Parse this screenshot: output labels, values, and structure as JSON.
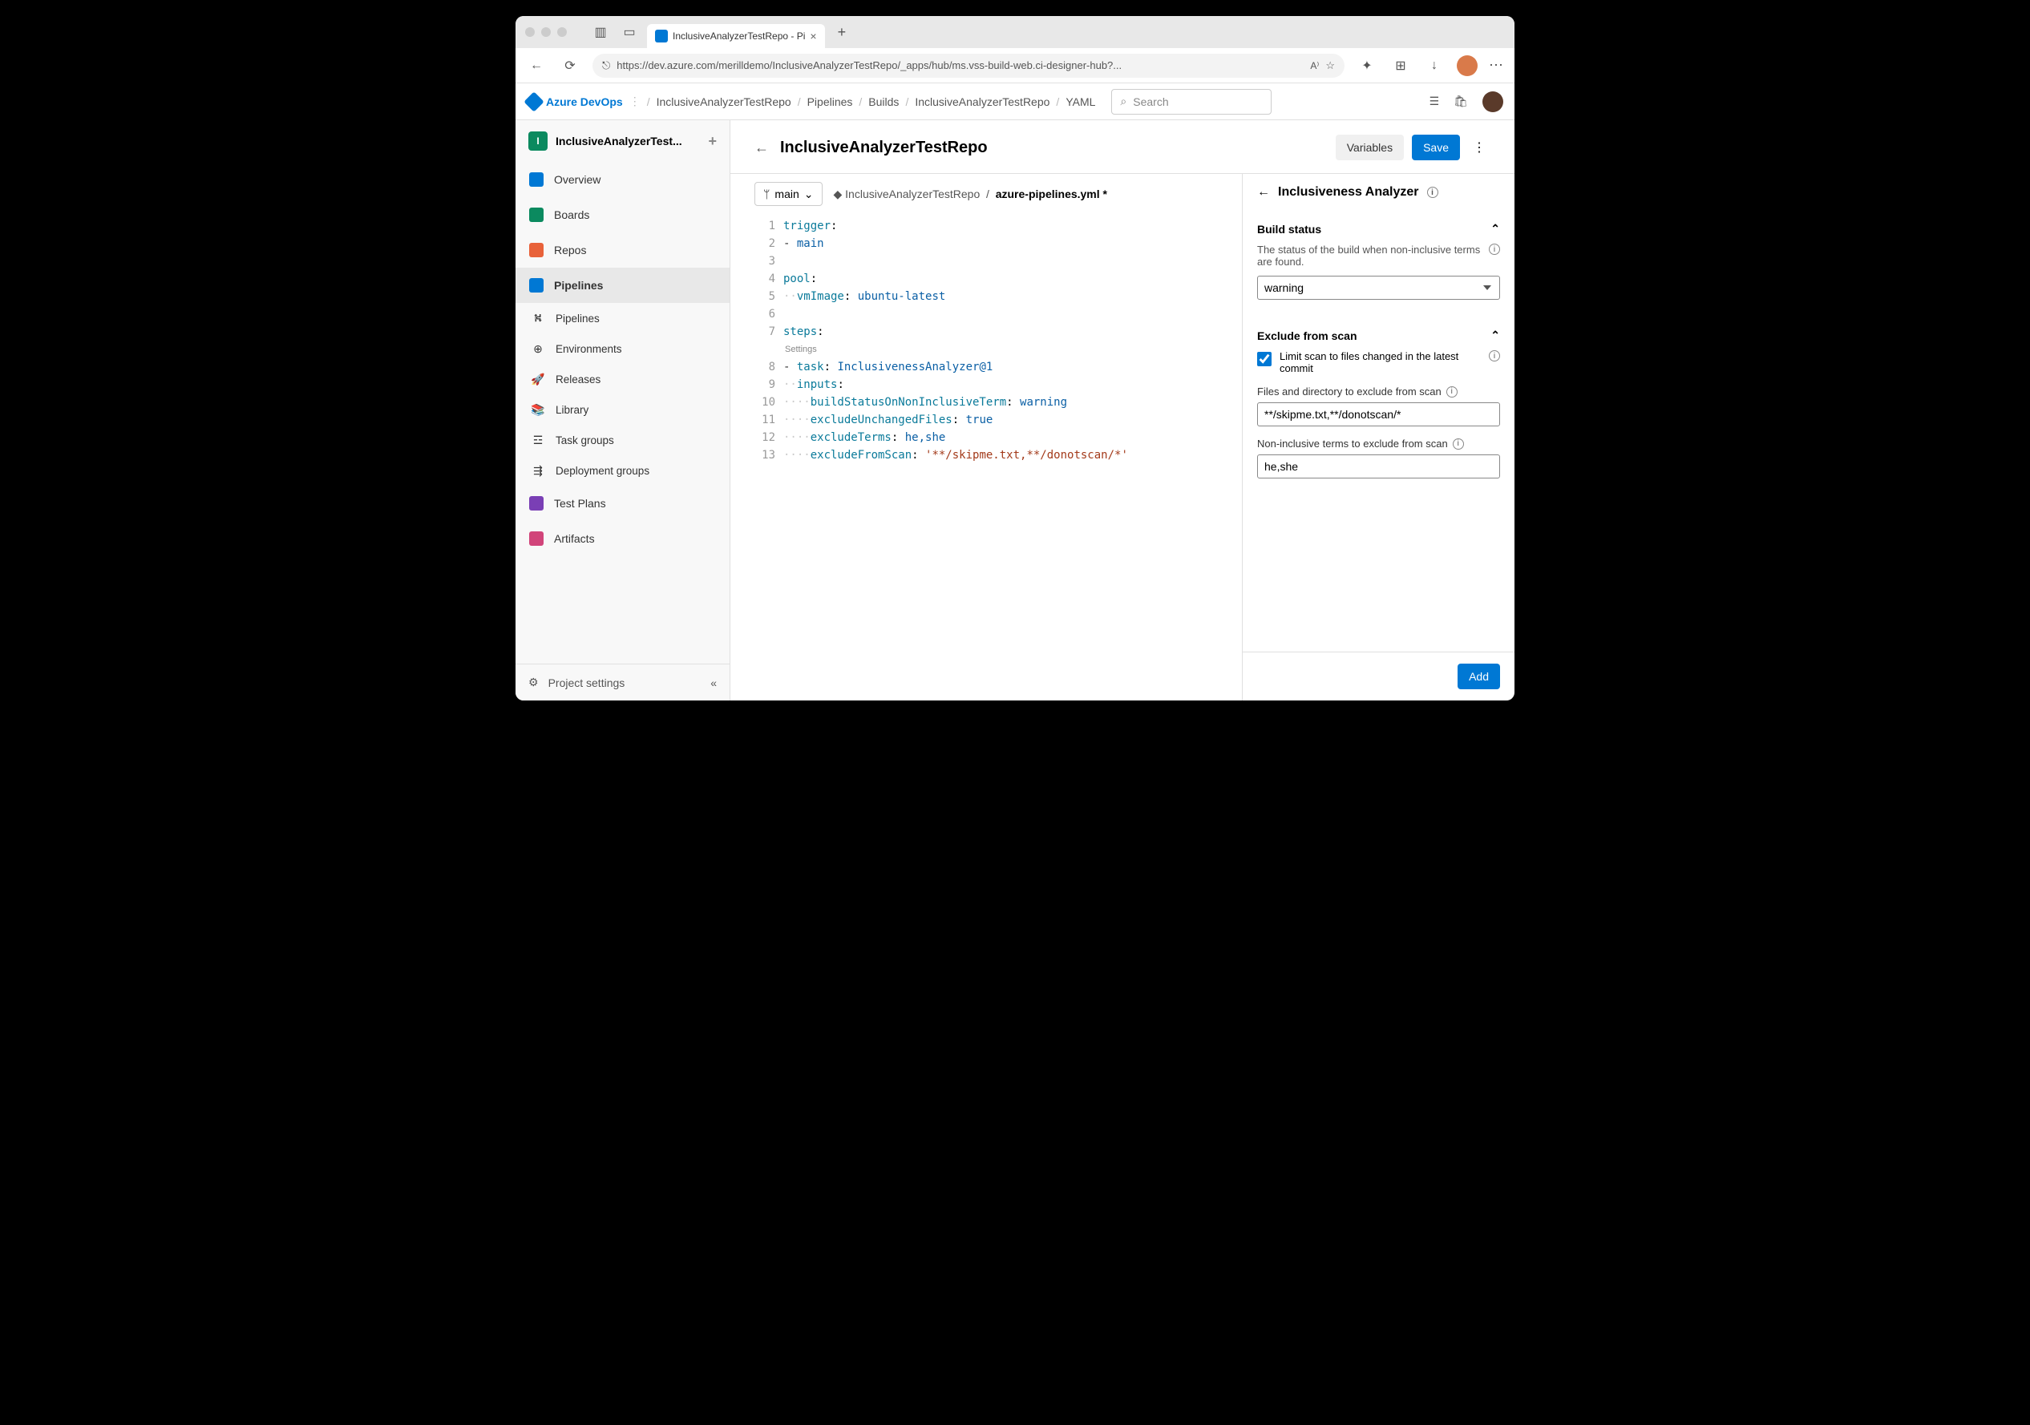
{
  "browser": {
    "tab_title": "InclusiveAnalyzerTestRepo - Pi",
    "url": "https://dev.azure.com/merilldemo/InclusiveAnalyzerTestRepo/_apps/hub/ms.vss-build-web.ci-designer-hub?..."
  },
  "header": {
    "product": "Azure DevOps",
    "breadcrumbs": [
      "InclusiveAnalyzerTestRepo",
      "Pipelines",
      "Builds",
      "InclusiveAnalyzerTestRepo",
      "YAML"
    ],
    "search_placeholder": "Search"
  },
  "sidebar": {
    "project": "InclusiveAnalyzerTest...",
    "items": [
      {
        "label": "Overview",
        "color": "#0078d4"
      },
      {
        "label": "Boards",
        "color": "#0b8a5f"
      },
      {
        "label": "Repos",
        "color": "#e8623a"
      },
      {
        "label": "Pipelines",
        "color": "#0078d4"
      }
    ],
    "subitems": [
      {
        "label": "Pipelines"
      },
      {
        "label": "Environments"
      },
      {
        "label": "Releases"
      },
      {
        "label": "Library"
      },
      {
        "label": "Task groups"
      },
      {
        "label": "Deployment groups"
      }
    ],
    "after": [
      {
        "label": "Test Plans",
        "color": "#7a3fb5"
      },
      {
        "label": "Artifacts",
        "color": "#d1447a"
      }
    ],
    "settings": "Project settings"
  },
  "page": {
    "title": "InclusiveAnalyzerTestRepo",
    "variables_btn": "Variables",
    "save_btn": "Save"
  },
  "editor": {
    "branch": "main",
    "repo": "InclusiveAnalyzerTestRepo",
    "file": "azure-pipelines.yml *",
    "codelens": "Settings",
    "lines": [
      [
        {
          "t": "key",
          "v": "trigger"
        },
        {
          "t": "p",
          "v": ":"
        }
      ],
      [
        {
          "t": "dash",
          "v": "- "
        },
        {
          "t": "val",
          "v": "main"
        }
      ],
      [],
      [
        {
          "t": "key",
          "v": "pool"
        },
        {
          "t": "p",
          "v": ":"
        }
      ],
      [
        {
          "t": "ws",
          "v": "··"
        },
        {
          "t": "key",
          "v": "vmImage"
        },
        {
          "t": "p",
          "v": ": "
        },
        {
          "t": "val",
          "v": "ubuntu-latest"
        }
      ],
      [],
      [
        {
          "t": "key",
          "v": "steps"
        },
        {
          "t": "p",
          "v": ":"
        }
      ],
      "__codelens__",
      [
        {
          "t": "dash",
          "v": "- "
        },
        {
          "t": "key",
          "v": "task"
        },
        {
          "t": "p",
          "v": ": "
        },
        {
          "t": "val",
          "v": "InclusivenessAnalyzer@1"
        }
      ],
      [
        {
          "t": "ws",
          "v": "··"
        },
        {
          "t": "key",
          "v": "inputs"
        },
        {
          "t": "p",
          "v": ":"
        }
      ],
      [
        {
          "t": "ws",
          "v": "····"
        },
        {
          "t": "key",
          "v": "buildStatusOnNonInclusiveTerm"
        },
        {
          "t": "p",
          "v": ": "
        },
        {
          "t": "val",
          "v": "warning"
        }
      ],
      [
        {
          "t": "ws",
          "v": "····"
        },
        {
          "t": "key",
          "v": "excludeUnchangedFiles"
        },
        {
          "t": "p",
          "v": ": "
        },
        {
          "t": "val",
          "v": "true"
        }
      ],
      [
        {
          "t": "ws",
          "v": "····"
        },
        {
          "t": "key",
          "v": "excludeTerms"
        },
        {
          "t": "p",
          "v": ": "
        },
        {
          "t": "val",
          "v": "he,she"
        }
      ],
      [
        {
          "t": "ws",
          "v": "····"
        },
        {
          "t": "key",
          "v": "excludeFromScan"
        },
        {
          "t": "p",
          "v": ": "
        },
        {
          "t": "str",
          "v": "'**/skipme.txt,**/donotscan/*'"
        }
      ]
    ]
  },
  "panel": {
    "title": "Inclusiveness Analyzer",
    "section1": {
      "title": "Build status",
      "desc": "The status of the build when non-inclusive terms are found.",
      "value": "warning"
    },
    "section2": {
      "title": "Exclude from scan",
      "check_label": "Limit scan to files changed in the latest commit",
      "checked": true,
      "files_label": "Files and directory to exclude from scan",
      "files_value": "**/skipme.txt,**/donotscan/*",
      "terms_label": "Non-inclusive terms to exclude from scan",
      "terms_value": "he,she"
    },
    "add_btn": "Add"
  }
}
